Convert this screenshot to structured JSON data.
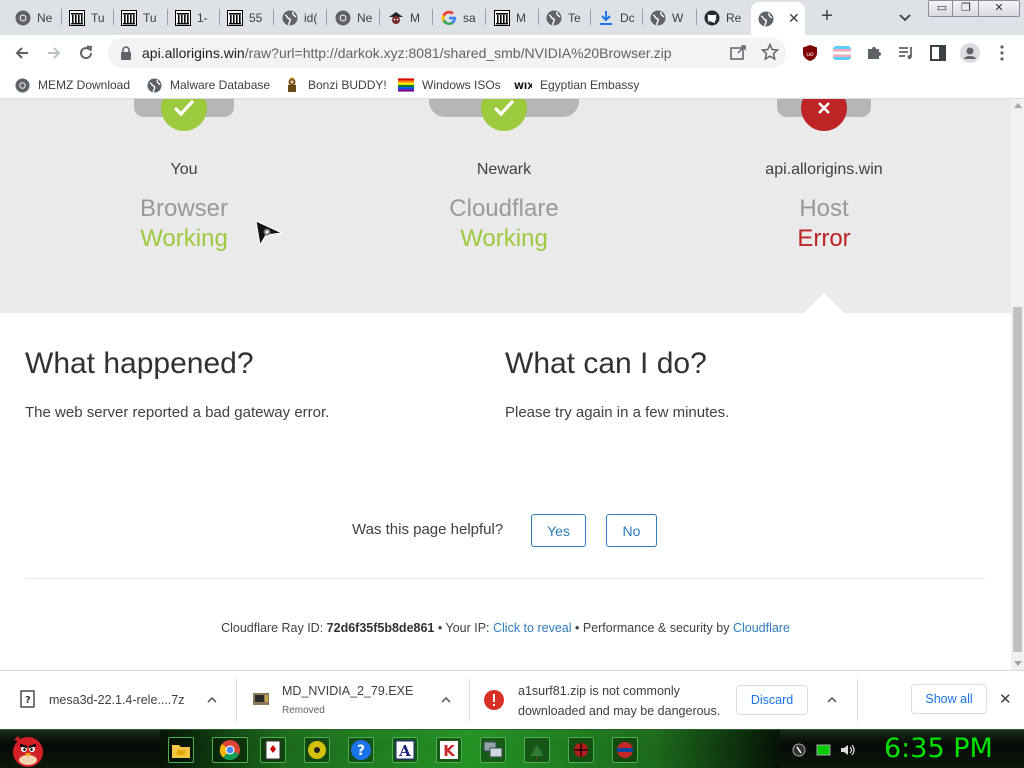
{
  "browser": {
    "tabs": [
      {
        "title": "Ne",
        "icon": "chrome-icon"
      },
      {
        "title": "Tu",
        "icon": "archive-icon"
      },
      {
        "title": "Tu",
        "icon": "archive-icon"
      },
      {
        "title": "1-",
        "icon": "archive-icon"
      },
      {
        "title": "55",
        "icon": "archive-icon"
      },
      {
        "title": "id(",
        "icon": "globe-icon"
      },
      {
        "title": "Ne",
        "icon": "chrome-icon"
      },
      {
        "title": "M",
        "icon": "pirate-icon"
      },
      {
        "title": "sa",
        "icon": "google-icon"
      },
      {
        "title": "M",
        "icon": "archive-icon"
      },
      {
        "title": "Te",
        "icon": "globe-icon"
      },
      {
        "title": "Dc",
        "icon": "download-icon"
      },
      {
        "title": "W",
        "icon": "globe-icon"
      },
      {
        "title": "Re",
        "icon": "github-icon"
      },
      {
        "title": "",
        "icon": "globe-icon",
        "active": true
      }
    ],
    "new_tab": "+",
    "window_controls": {
      "minimize": "▭",
      "restore": "❐",
      "close": "✕"
    },
    "url_host": "api.allorigins.win",
    "url_rest": "/raw?url=http://darkok.xyz:8081/shared_smb/NVIDIA%20Browser.zip",
    "bookmarks": [
      {
        "label": "MEMZ Download",
        "icon": "chrome-icon"
      },
      {
        "label": "Malware Database",
        "icon": "globe-icon"
      },
      {
        "label": "Bonzi BUDDY!",
        "icon": "bonzi-icon"
      },
      {
        "label": "Windows ISOs",
        "icon": "rainbow-flag-icon"
      },
      {
        "label": "Egyptian Embassy",
        "icon": "wix-icon"
      }
    ]
  },
  "error_page": {
    "stations": [
      {
        "location": "You",
        "role": "Browser",
        "status": "Working",
        "state": "ok"
      },
      {
        "location": "Newark",
        "role": "Cloudflare",
        "status": "Working",
        "state": "ok"
      },
      {
        "location": "api.allorigins.win",
        "role": "Host",
        "status": "Error",
        "state": "error"
      }
    ],
    "what_happened": {
      "heading": "What happened?",
      "body": "The web server reported a bad gateway error."
    },
    "what_can_i_do": {
      "heading": "What can I do?",
      "body": "Please try again in a few minutes."
    },
    "feedback": {
      "question": "Was this page helpful?",
      "yes": "Yes",
      "no": "No"
    },
    "footer": {
      "ray_label": "Cloudflare Ray ID:",
      "ray_id": "72d6f35f5b8de861",
      "sep1": "•",
      "ip_label": "Your IP:",
      "ip_link": "Click to reveal",
      "sep2": "•",
      "perf_label": "Performance & security by",
      "perf_link": "Cloudflare"
    },
    "colors": {
      "ok": "#9bca3e",
      "error": "#bd2426",
      "link": "#2f7bbf"
    }
  },
  "downloads": {
    "items": [
      {
        "name": "mesa3d-22.1.4-rele....7z",
        "sub": ""
      },
      {
        "name": "MD_NVIDIA_2_79.EXE",
        "sub": "Removed"
      },
      {
        "name_line1": "a1surf81.zip is not commonly",
        "name_line2": "downloaded and may be dangerous.",
        "action": "Discard"
      }
    ],
    "show_all": "Show all",
    "close": "✕"
  },
  "taskbar": {
    "clock": "6:35 PM",
    "icons": [
      "angry-bird-icon",
      "explorer-icon",
      "chrome-icon",
      "solitaire-icon",
      "cd-icon",
      "help-icon",
      "font-icon",
      "k-icon",
      "network-icon",
      "tree-icon",
      "spider-icon",
      "badge-icon"
    ]
  }
}
